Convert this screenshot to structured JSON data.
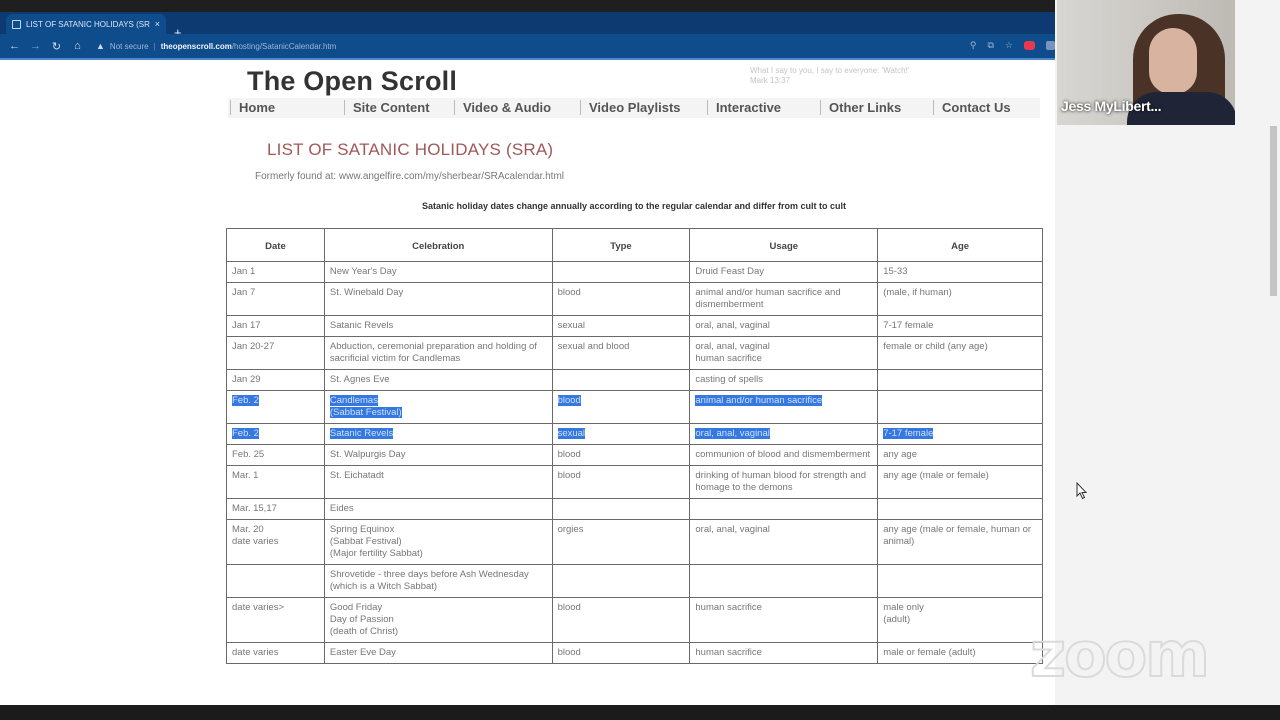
{
  "browser": {
    "tab_title": "LIST OF SATANIC HOLIDAYS (SR...",
    "tab_close": "×",
    "new_tab": "+",
    "nav": {
      "back": "←",
      "forward": "→",
      "reload": "↻",
      "home": "⌂"
    },
    "address": {
      "warning_icon": "▲",
      "not_secure": "Not secure",
      "separator": "|",
      "host": "theopenscroll.com",
      "path": "/hosting/SatanicCalendar.htm"
    },
    "toolbar_icons": [
      "search-icon",
      "share-icon",
      "star-icon",
      "extension-icon",
      "extension2-icon"
    ],
    "toolbar_glyphs": {
      "search": "⚲",
      "share": "⧉",
      "star": "☆"
    }
  },
  "site": {
    "title": "The Open Scroll",
    "verse_line1": "What I say to you, I say to everyone: 'Watch!'",
    "verse_line2": "Mark 13:37",
    "nav": [
      "Home",
      "Site Content",
      "Video & Audio",
      "Video Playlists",
      "Interactive",
      "Other Links",
      "Contact Us"
    ]
  },
  "content": {
    "list_title": "LIST OF SATANIC HOLIDAYS (SRA)",
    "formerly": "Formerly found at: www.angelfire.com/my/sherbear/SRAcalendar.html",
    "note": "Satanic holiday dates change annually according to the regular calendar and differ from cult to cult",
    "table": {
      "headers": [
        "Date",
        "Celebration",
        "Type",
        "Usage",
        "Age"
      ],
      "rows": [
        {
          "date": "Jan 1",
          "celebration": "New Year's Day",
          "type": "",
          "usage": "Druid Feast Day",
          "age": "15-33",
          "selected": false
        },
        {
          "date": "Jan 7",
          "celebration": "St. Winebald Day",
          "type": "blood",
          "usage": "animal and/or human sacrifice and dismemberment",
          "age": "(male, if human)",
          "selected": false
        },
        {
          "date": "Jan 17",
          "celebration": "Satanic Revels",
          "type": "sexual",
          "usage": "oral, anal, vaginal",
          "age": "7-17 female",
          "selected": false
        },
        {
          "date": "Jan 20-27",
          "celebration": "Abduction, ceremonial preparation and holding of sacrificial victim for Candlemas",
          "type": "sexual and blood",
          "usage": "oral, anal, vaginal\nhuman sacrifice",
          "age": "female or child (any age)",
          "selected": false
        },
        {
          "date": "Jan 29",
          "celebration": "St. Agnes Eve",
          "type": "",
          "usage": "casting of spells",
          "age": "",
          "selected": false
        },
        {
          "date": "Feb. 2",
          "celebration": "Candlemas\n(Sabbat Festival)",
          "type": "blood",
          "usage": "animal and/or human sacrifice",
          "age": " ",
          "selected": true
        },
        {
          "date": "Feb. 2",
          "celebration": "Satanic Revels",
          "type": "sexual",
          "usage": "oral, anal, vaginal",
          "age": "7-17 female",
          "selected": true
        },
        {
          "date": "Feb. 25",
          "celebration": "St. Walpurgis Day",
          "type": "blood",
          "usage": "communion of blood and dismemberment",
          "age": "any age",
          "selected": false
        },
        {
          "date": "Mar. 1",
          "celebration": "St. Eichatadt",
          "type": "blood",
          "usage": "drinking of human blood for strength and homage to the demons",
          "age": "any age (male or female)",
          "selected": false
        },
        {
          "date": "Mar. 15,17",
          "celebration": "Eides",
          "type": "",
          "usage": "",
          "age": "",
          "selected": false
        },
        {
          "date": "Mar. 20\ndate varies",
          "celebration": "Spring Equinox\n(Sabbat Festival)\n(Major fertility Sabbat)",
          "type": "orgies",
          "usage": "oral, anal, vaginal",
          "age": "any age (male or female, human or animal)",
          "selected": false
        },
        {
          "date": "",
          "celebration": "Shrovetide - three days before Ash Wednesday\n(which is a Witch Sabbat)",
          "type": "",
          "usage": "",
          "age": "",
          "selected": false
        },
        {
          "date": "date varies>",
          "celebration": "Good Friday\nDay of Passion\n(death of Christ)",
          "type": "blood",
          "usage": "human sacrifice",
          "age": "male only\n(adult)",
          "selected": false
        },
        {
          "date": "date varies",
          "celebration": "Easter Eve Day",
          "type": "blood",
          "usage": "human sacrifice",
          "age": "male or female (adult)",
          "selected": false
        }
      ]
    }
  },
  "zoom": {
    "participant_name": "Jess MyLibert...",
    "watermark": "zoom"
  }
}
